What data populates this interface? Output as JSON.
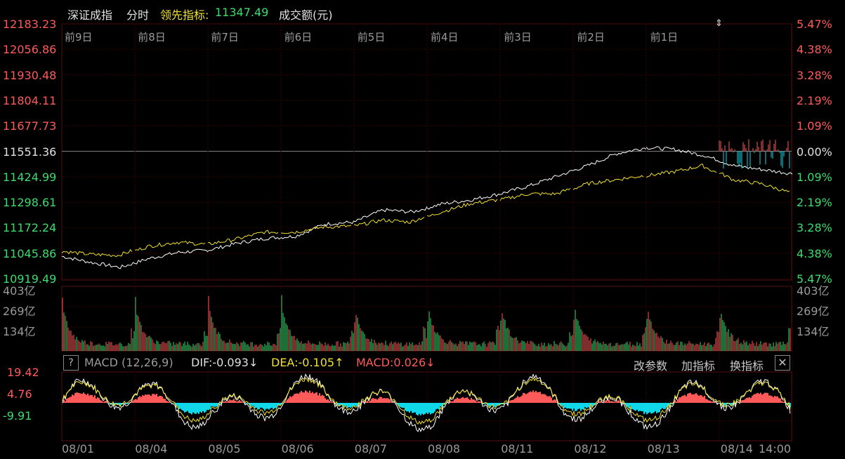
{
  "header": {
    "title": "深证成指",
    "mode": "分时",
    "leading_indicator": "领先指标:",
    "leading_value": "11347.49",
    "volume_label": "成交额(元)"
  },
  "price_axis": [
    "12183.23",
    "12056.86",
    "11930.48",
    "11804.11",
    "11677.73",
    "11551.36",
    "11424.99",
    "11298.61",
    "11172.24",
    "11045.86",
    "10919.49"
  ],
  "pct_axis": [
    "5.47%",
    "4.38%",
    "3.28%",
    "2.19%",
    "1.09%",
    "0.00%",
    "1.09%",
    "2.19%",
    "3.28%",
    "4.38%",
    "5.47%"
  ],
  "day_labels": [
    "前9日",
    "前8日",
    "前7日",
    "前6日",
    "前5日",
    "前4日",
    "前3日",
    "前2日",
    "前1日"
  ],
  "volume_axis": [
    "403亿",
    "269亿",
    "134亿"
  ],
  "macd": {
    "help": "?",
    "name": "MACD (12,26,9)",
    "dif": "DIF:-0.093↓",
    "dea": "DEA:-0.105↑",
    "macd": "MACD:0.026↓",
    "axis": [
      "19.42",
      "4.76",
      "-9.91"
    ],
    "buttons": [
      "改参数",
      "加指标",
      "换指标"
    ],
    "close": "✕"
  },
  "date_axis": [
    "08/01",
    "08/04",
    "08/05",
    "08/06",
    "08/07",
    "08/08",
    "08/11",
    "08/12",
    "08/13",
    "08/14",
    "14:00"
  ],
  "colors": {
    "up": "#ff5a5a",
    "down": "#3cdc6e",
    "dif": "#ffffff",
    "dea": "#f0e030",
    "neg_bar": "#10d8e8"
  },
  "chart_data": {
    "type": "line",
    "series": [
      {
        "values": [
          11030,
          11000,
          10975,
          11020,
          11050,
          11060,
          11095,
          11120,
          11130,
          11190,
          11200,
          11260,
          11250,
          11290,
          11310,
          11340,
          11380,
          11430,
          11480,
          11540,
          11570,
          11560,
          11530,
          11480,
          11460,
          11440
        ]
      },
      {
        "values": [
          11055,
          11040,
          11035,
          11080,
          11100,
          11090,
          11115,
          11150,
          11150,
          11175,
          11180,
          11210,
          11200,
          11250,
          11290,
          11310,
          11340,
          11340,
          11390,
          11410,
          11430,
          11450,
          11480,
          11410,
          11390,
          11347
        ]
      }
    ],
    "ylim": [
      10919.49,
      12183.23
    ]
  }
}
